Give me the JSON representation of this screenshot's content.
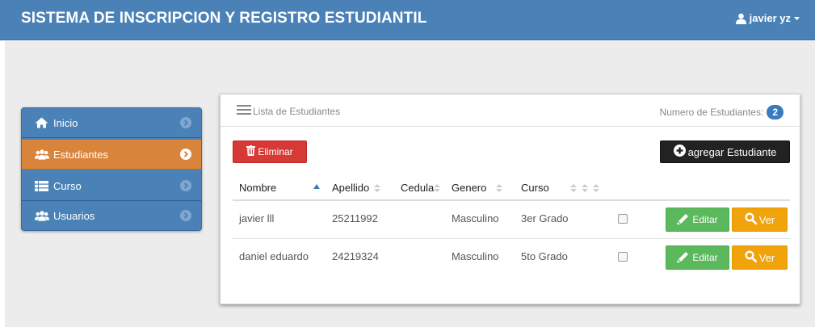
{
  "header": {
    "title": "SISTEMA DE INSCRIPCION Y REGISTRO ESTUDIANTIL",
    "user": "javier yz"
  },
  "sidebar": {
    "items": [
      {
        "label": "Inicio",
        "icon": "home-icon"
      },
      {
        "label": "Estudiantes",
        "icon": "users-icon",
        "active": true
      },
      {
        "label": "Curso",
        "icon": "list-icon"
      },
      {
        "label": "Usuarios",
        "icon": "users-icon"
      }
    ]
  },
  "panel": {
    "title": "Lista de Estudiantes",
    "count_label": "Numero de Estudiantes:",
    "count": "2",
    "delete_label": "Eliminar",
    "add_label": "agregar Estudiante"
  },
  "table": {
    "columns": [
      "Nombre",
      "Apellido",
      "Cedula",
      "Genero",
      "Curso"
    ],
    "rows": [
      {
        "nombre": "javier lll",
        "apellido": "25211992",
        "cedula": "",
        "genero": "Masculino",
        "curso": "3er Grado"
      },
      {
        "nombre": "daniel eduardo",
        "apellido": "24219324",
        "cedula": "",
        "genero": "Masculino",
        "curso": "5to Grado"
      }
    ],
    "edit_label": "Editar",
    "view_label": "Ver"
  },
  "colors": {
    "topbar": "#4a82b8",
    "active": "#d9843b",
    "danger": "#d73a36",
    "success": "#5cb85c",
    "warning": "#f0a30a",
    "badge": "#3a7bbf"
  }
}
